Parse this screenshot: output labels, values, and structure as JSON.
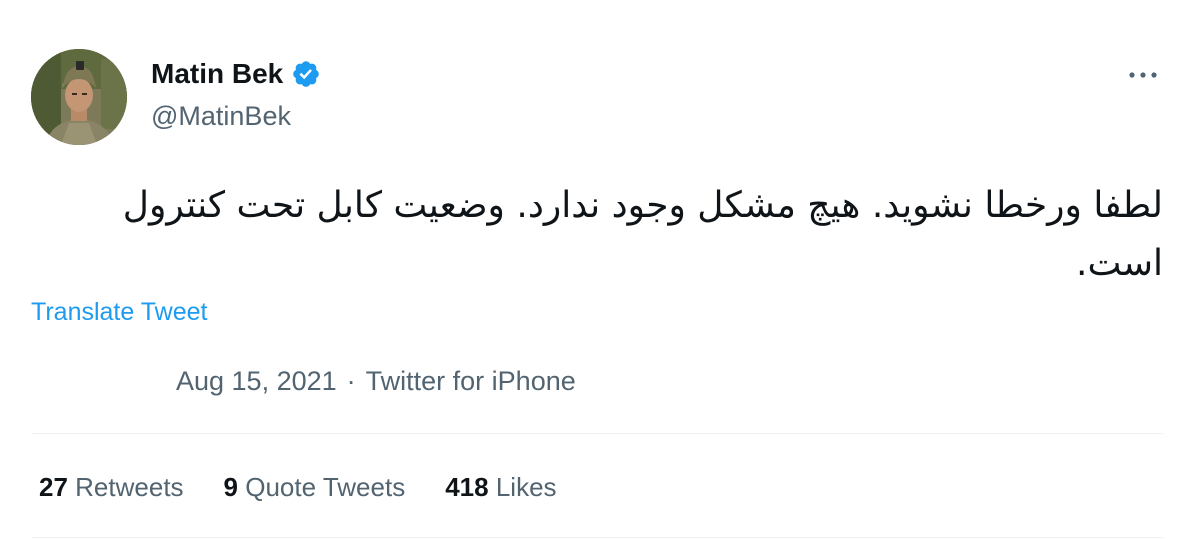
{
  "user": {
    "display_name": "Matin Bek",
    "handle": "@MatinBek",
    "verified": true
  },
  "tweet": {
    "text": "لطفا ورخطا نشوید. هیچ مشکل وجود ندارد. وضعیت کابل تحت کنترول است.",
    "translate_label": "Translate Tweet",
    "date": "Aug 15, 2021",
    "separator": "·",
    "source": "Twitter for iPhone"
  },
  "stats": {
    "retweets": {
      "count": "27",
      "label": "Retweets"
    },
    "quotes": {
      "count": "9",
      "label": "Quote Tweets"
    },
    "likes": {
      "count": "418",
      "label": "Likes"
    }
  },
  "colors": {
    "accent": "#1d9bf0",
    "secondary_text": "#536471",
    "primary_text": "#0f1419",
    "divider": "#eff3f4"
  },
  "icons": {
    "verified": "verified-badge-icon",
    "more": "more-options-icon"
  }
}
